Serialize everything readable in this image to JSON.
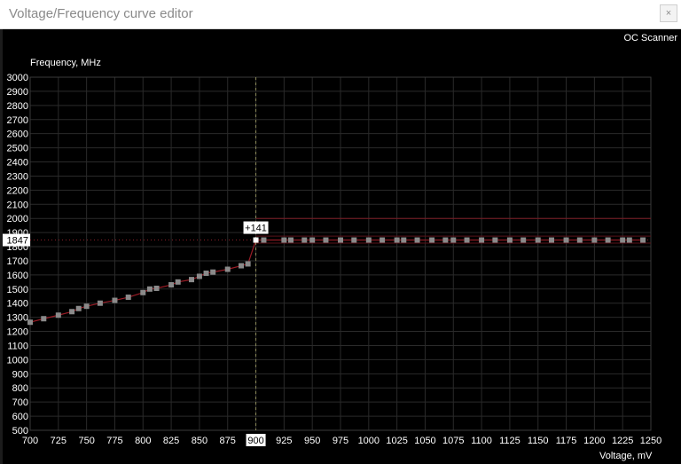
{
  "window": {
    "title": "Voltage/Frequency curve editor",
    "close_label": "×"
  },
  "toolbar": {
    "oc_scanner_label": "OC Scanner"
  },
  "chart_data": {
    "type": "line",
    "ylabel": "Frequency, MHz",
    "xlabel": "Voltage, mV",
    "xlim": [
      700,
      1250
    ],
    "ylim": [
      500,
      3000
    ],
    "x_ticks": [
      700,
      725,
      750,
      775,
      800,
      825,
      850,
      875,
      900,
      925,
      950,
      975,
      1000,
      1025,
      1050,
      1075,
      1100,
      1125,
      1150,
      1175,
      1200,
      1225,
      1250
    ],
    "y_ticks": [
      500,
      600,
      700,
      800,
      900,
      1000,
      1100,
      1200,
      1300,
      1400,
      1500,
      1600,
      1700,
      1800,
      1900,
      2000,
      2100,
      2200,
      2300,
      2400,
      2500,
      2600,
      2700,
      2800,
      2900,
      3000
    ],
    "grid": true,
    "selected_voltage": 900,
    "selected_voltage_label": "900",
    "current_frequency": 1847,
    "current_frequency_label": "1847",
    "offset_label": "+141",
    "limit_frequency": 2000,
    "upper_band": 1875,
    "lower_band": 1825,
    "series": [
      {
        "values": [
          [
            700,
            1265
          ],
          [
            712,
            1290
          ],
          [
            725,
            1315
          ],
          [
            737,
            1340
          ],
          [
            743,
            1362
          ],
          [
            750,
            1378
          ],
          [
            762,
            1400
          ],
          [
            775,
            1420
          ],
          [
            787,
            1442
          ],
          [
            800,
            1475
          ],
          [
            806,
            1500
          ],
          [
            812,
            1505
          ],
          [
            825,
            1530
          ],
          [
            831,
            1550
          ],
          [
            843,
            1567
          ],
          [
            850,
            1590
          ],
          [
            856,
            1612
          ],
          [
            862,
            1620
          ],
          [
            875,
            1640
          ],
          [
            887,
            1665
          ],
          [
            893,
            1678
          ],
          [
            900,
            1847
          ],
          [
            907,
            1847
          ],
          [
            925,
            1847
          ],
          [
            931,
            1847
          ],
          [
            943,
            1847
          ],
          [
            950,
            1847
          ],
          [
            962,
            1847
          ],
          [
            975,
            1847
          ],
          [
            987,
            1847
          ],
          [
            1000,
            1847
          ],
          [
            1012,
            1847
          ],
          [
            1025,
            1847
          ],
          [
            1031,
            1847
          ],
          [
            1043,
            1847
          ],
          [
            1056,
            1847
          ],
          [
            1068,
            1847
          ],
          [
            1075,
            1847
          ],
          [
            1087,
            1847
          ],
          [
            1100,
            1847
          ],
          [
            1112,
            1847
          ],
          [
            1125,
            1847
          ],
          [
            1137,
            1847
          ],
          [
            1150,
            1847
          ],
          [
            1162,
            1847
          ],
          [
            1175,
            1847
          ],
          [
            1187,
            1847
          ],
          [
            1200,
            1847
          ],
          [
            1212,
            1847
          ],
          [
            1225,
            1847
          ],
          [
            1231,
            1847
          ],
          [
            1243,
            1847
          ]
        ]
      }
    ]
  }
}
